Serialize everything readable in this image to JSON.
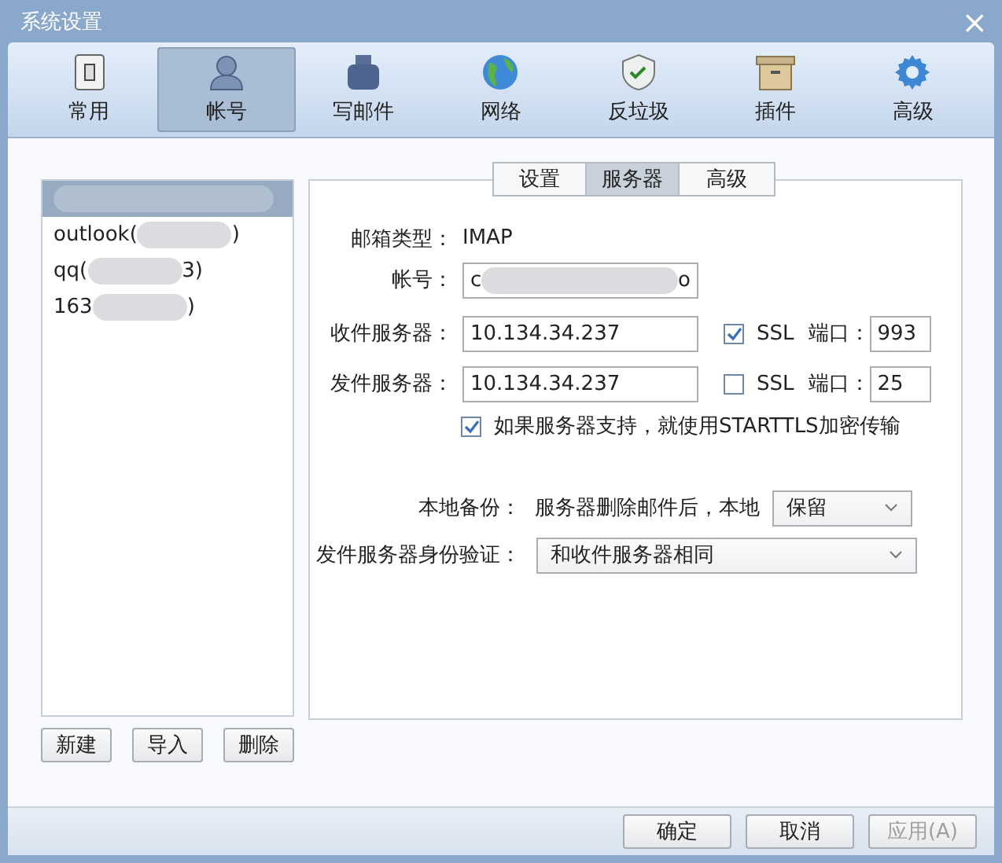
{
  "window": {
    "title": "系统设置",
    "close": "×"
  },
  "toolbar": [
    {
      "label": "常用",
      "selected": false
    },
    {
      "label": "帐号",
      "selected": true
    },
    {
      "label": "写邮件",
      "selected": false
    },
    {
      "label": "网络",
      "selected": false
    },
    {
      "label": "反垃圾",
      "selected": false
    },
    {
      "label": "插件",
      "selected": false
    },
    {
      "label": "高级",
      "selected": false
    }
  ],
  "accounts": [
    {
      "selected": true
    },
    {
      "prefix": "outlook(",
      "suffix": ")",
      "selected": false
    },
    {
      "prefix": "qq(",
      "suffix": "3)",
      "selected": false
    },
    {
      "prefix": "163",
      "suffix": ")",
      "selected": false
    }
  ],
  "account_buttons": [
    "新建",
    "导入",
    "删除"
  ],
  "tabs": [
    {
      "label": "设置",
      "selected": false
    },
    {
      "label": "服务器",
      "selected": true
    },
    {
      "label": "高级",
      "selected": false
    }
  ],
  "mailbox_type": {
    "label": "邮箱类型：",
    "value": "IMAP"
  },
  "account": {
    "label": "帐号：",
    "prefix": "c",
    "suffix": "o"
  },
  "servers": [
    {
      "label": "收件服务器：",
      "value": "10.134.34.237",
      "ssl_checked": true,
      "ssl_label": "SSL",
      "port_label": "端口：",
      "port": "993"
    },
    {
      "label": "发件服务器：",
      "value": "10.134.34.237",
      "ssl_checked": false,
      "ssl_label": "SSL",
      "port_label": "端口：",
      "port": "25"
    }
  ],
  "starttls": {
    "label": "如果服务器支持，就使用STARTTLS加密传输",
    "checked": true
  },
  "backup": {
    "label": "本地备份：",
    "text": "服务器删除邮件后，本地",
    "value": "保留"
  },
  "auth": {
    "label": "发件服务器身份验证：",
    "value": "和收件服务器相同"
  },
  "footer_buttons": [
    {
      "label": "确定",
      "disabled": false
    },
    {
      "label": "取消",
      "disabled": false
    },
    {
      "label": "应用(A)",
      "disabled": true
    }
  ]
}
